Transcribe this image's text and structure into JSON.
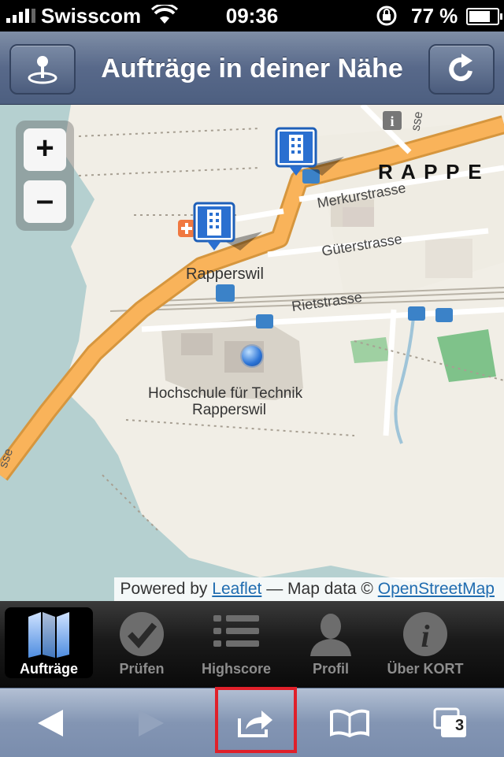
{
  "status_bar": {
    "carrier": "Swisscom",
    "time": "09:36",
    "battery_text": "77 %",
    "battery_level": 0.77
  },
  "header": {
    "title": "Aufträge in deiner Nähe",
    "left_icon": "locate-pin-icon",
    "right_icon": "refresh-icon"
  },
  "map": {
    "zoom_in_label": "+",
    "zoom_out_label": "–",
    "labels": {
      "town": "R A P P E",
      "street_merkur": "Merkurstrasse",
      "street_gueter": "Güterstrasse",
      "street_riet": "Rietstrasse",
      "place_rapperswil": "Rapperswil",
      "uni_line1": "Hochschule für Technik",
      "uni_line2": "Rapperswil",
      "road_edge": "sse",
      "road_edge2": "sse"
    },
    "attribution": {
      "prefix": "Powered by",
      "leaflet": "Leaflet",
      "middle": "— Map data ©",
      "osm": "OpenStreetMap"
    },
    "colors": {
      "land": "#f1eee6",
      "water": "#b5d0d0",
      "main_road": "#f9b35a",
      "park": "#7fc28a",
      "marker": "#2a6fd0"
    }
  },
  "tabs": [
    {
      "label": "Aufträge",
      "icon": "map-icon",
      "active": true
    },
    {
      "label": "Prüfen",
      "icon": "checkmark-icon",
      "active": false
    },
    {
      "label": "Highscore",
      "icon": "list-icon",
      "active": false
    },
    {
      "label": "Profil",
      "icon": "user-icon",
      "active": false
    },
    {
      "label": "Über KORT",
      "icon": "info-icon",
      "active": false
    }
  ],
  "browser_toolbar": {
    "tabs_count": "3",
    "icons": [
      "back-icon",
      "forward-icon",
      "share-icon",
      "bookmarks-icon",
      "pages-icon"
    ]
  }
}
